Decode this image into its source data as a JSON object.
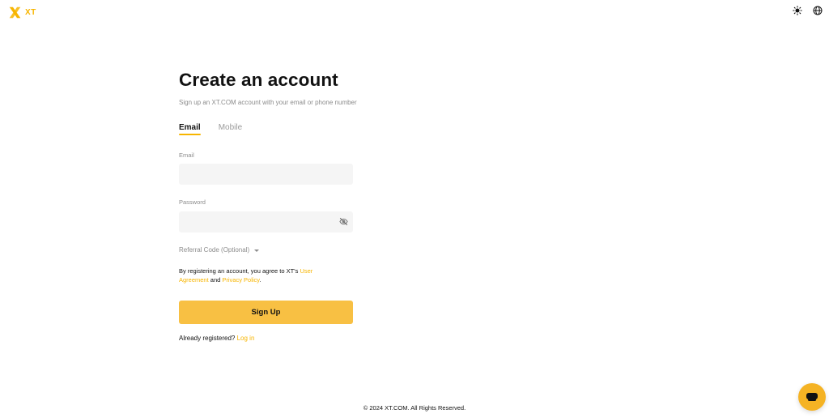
{
  "header": {
    "brand": "XT",
    "brand_color": "#F7B500",
    "icons": [
      "theme-toggle-sun-icon",
      "language-globe-icon"
    ]
  },
  "form": {
    "title": "Create an account",
    "subtitle": "Sign up an XT.COM account with your email or phone number",
    "tabs": [
      {
        "label": "Email",
        "active": true
      },
      {
        "label": "Mobile",
        "active": false
      }
    ],
    "email": {
      "label": "Email",
      "value": "",
      "placeholder": ""
    },
    "password": {
      "label": "Password",
      "value": "",
      "placeholder": "",
      "icon": "eye-off-icon"
    },
    "referral_label": "Referral Code (Optional)",
    "agreement": {
      "prefix": "By registering an account, you agree to XT's ",
      "user_agreement": "User Agreement",
      "and": " and ",
      "privacy_policy": "Privacy Policy",
      "suffix": "."
    },
    "signup_label": "Sign Up",
    "signup_color": "#F8C043",
    "already_text": "Already registered? ",
    "login_link": "Log in"
  },
  "footer": {
    "copyright": "© 2024 XT.COM. All Rights Reserved."
  },
  "chat": {
    "icon": "chat-support-icon",
    "color": "#F5B324"
  }
}
